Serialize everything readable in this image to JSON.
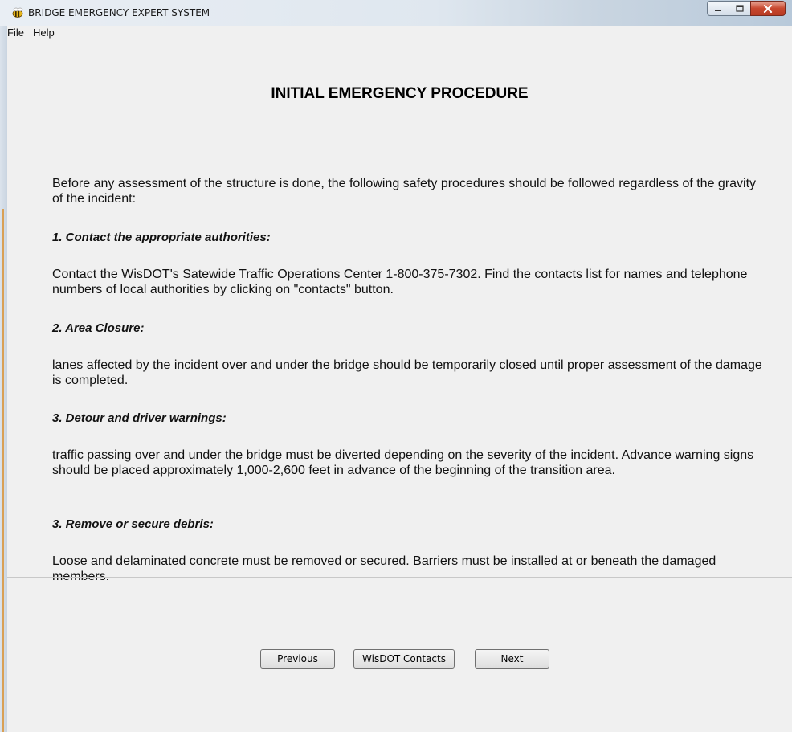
{
  "window": {
    "title": "BRIDGE EMERGENCY EXPERT SYSTEM"
  },
  "menu": {
    "file": "File",
    "help": "Help"
  },
  "page": {
    "heading": "INITIAL EMERGENCY PROCEDURE",
    "intro": "Before any assessment of the structure is done, the following safety procedures should be followed regardless of the gravity of the incident:",
    "steps": [
      {
        "title": "1.  Contact the appropriate authorities:",
        "body": "Contact the WisDOT's Satewide Traffic Operations Center 1-800-375-7302. Find the contacts list for names and telephone numbers of local authorities by clicking on \"contacts\" button."
      },
      {
        "title": "2.  Area Closure:",
        "body": "lanes affected by the incident over and under the bridge should be temporarily closed until proper assessment of the damage is completed."
      },
      {
        "title": "3.  Detour and driver warnings:",
        "body": "traffic passing over and under the bridge must be diverted depending on the severity of the incident. Advance warning signs should be placed approximately 1,000-2,600 feet in advance of the beginning of the transition area."
      },
      {
        "title": "3.  Remove or secure debris:",
        "body": "Loose and delaminated concrete must be removed or secured. Barriers must be installed at or beneath the damaged members."
      }
    ]
  },
  "buttons": {
    "previous": "Previous",
    "contacts": "WisDOT Contacts",
    "next": "Next"
  },
  "icons": {
    "app": "bee-icon",
    "minimize": "minimize-icon",
    "maximize": "maximize-icon",
    "close": "close-icon"
  },
  "colors": {
    "close_button": "#c8482f",
    "window_frame": "#dde4ec",
    "panel": "#f0f0f0"
  }
}
